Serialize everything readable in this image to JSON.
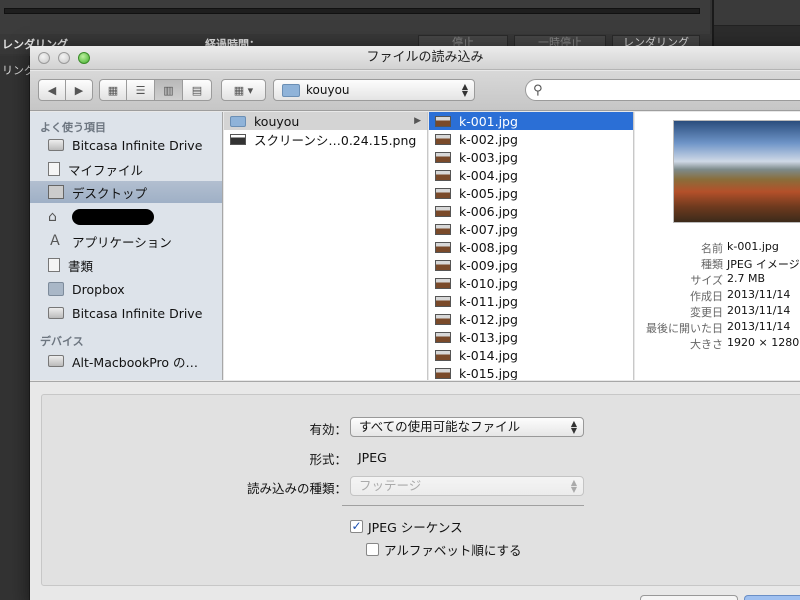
{
  "background_app": {
    "render_label": "レンダリング",
    "elapsed_label": "経過時間：",
    "stop_button": "停止",
    "pause_button": "一時停止",
    "render_button": "レンダリング",
    "left_label": "リング"
  },
  "dialog": {
    "title": "ファイルの読み込み",
    "path_popup": "kouyou",
    "search_placeholder": ""
  },
  "sidebar": {
    "favorites_header": "よく使う項目",
    "favorites": [
      {
        "label": "Bitcasa Infinite Drive",
        "icon": "drive-icon"
      },
      {
        "label": "マイファイル",
        "icon": "all-my-files-icon"
      },
      {
        "label": "デスクトップ",
        "icon": "desktop-icon",
        "selected": true
      },
      {
        "label": "",
        "icon": "home-icon",
        "redacted": true
      },
      {
        "label": "アプリケーション",
        "icon": "applications-icon"
      },
      {
        "label": "書類",
        "icon": "documents-icon"
      },
      {
        "label": "Dropbox",
        "icon": "folder-icon"
      },
      {
        "label": "Bitcasa Infinite Drive",
        "icon": "drive-icon"
      }
    ],
    "devices_header": "デバイス",
    "devices": [
      {
        "label": "Alt-MacbookPro の…",
        "icon": "computer-icon"
      }
    ]
  },
  "column1": {
    "items": [
      {
        "name": "kouyou",
        "type": "folder",
        "selected": true
      },
      {
        "name": "スクリーンシ…0.24.15.png",
        "type": "png"
      }
    ]
  },
  "column2": {
    "items": [
      "k-001.jpg",
      "k-002.jpg",
      "k-003.jpg",
      "k-004.jpg",
      "k-005.jpg",
      "k-006.jpg",
      "k-007.jpg",
      "k-008.jpg",
      "k-009.jpg",
      "k-010.jpg",
      "k-011.jpg",
      "k-012.jpg",
      "k-013.jpg",
      "k-014.jpg",
      "k-015.jpg"
    ],
    "selected_index": 0
  },
  "preview_info": {
    "name_key": "名前",
    "name": "k-001.jpg",
    "kind_key": "種類",
    "kind": "JPEG イメージ",
    "size_key": "サイズ",
    "size": "2.7 MB",
    "created_key": "作成日",
    "created": "2013/11/14",
    "modified_key": "変更日",
    "modified": "2013/11/14",
    "opened_key": "最後に開いた日",
    "opened": "2013/11/14",
    "dims_key": "大きさ",
    "dims": "1920 × 1280"
  },
  "options": {
    "enable_label": "有効：",
    "enable_value": "すべての使用可能なファイル",
    "format_label": "形式：",
    "format_value": "JPEG",
    "import_as_label": "読み込みの種類：",
    "import_as_value": "フッテージ",
    "jpeg_sequence_label": "JPEG シーケンス",
    "jpeg_sequence_checked": true,
    "alphabetical_label": "アルファベット順にする",
    "alphabetical_checked": false
  }
}
